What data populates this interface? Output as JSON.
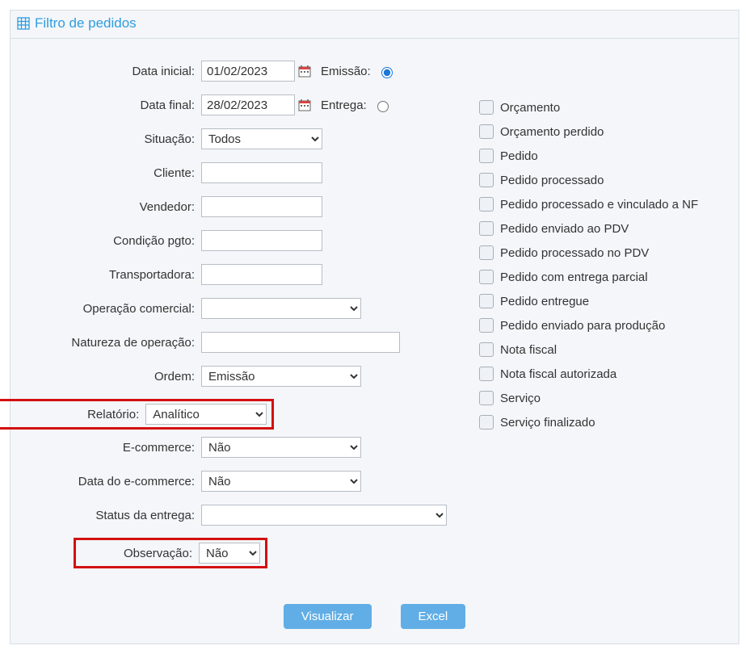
{
  "header": {
    "title": "Filtro de pedidos"
  },
  "form": {
    "data_inicial_label": "Data inicial:",
    "data_inicial_value": "01/02/2023",
    "data_final_label": "Data final:",
    "data_final_value": "28/02/2023",
    "emissao_label": "Emissão:",
    "entrega_label": "Entrega:",
    "situacao_label": "Situação:",
    "situacao_value": "Todos",
    "cliente_label": "Cliente:",
    "cliente_value": "",
    "vendedor_label": "Vendedor:",
    "vendedor_value": "",
    "condicao_pgto_label": "Condição pgto:",
    "condicao_pgto_value": "",
    "transportadora_label": "Transportadora:",
    "transportadora_value": "",
    "operacao_comercial_label": "Operação comercial:",
    "operacao_comercial_value": "",
    "natureza_operacao_label": "Natureza de operação:",
    "natureza_operacao_value": "",
    "ordem_label": "Ordem:",
    "ordem_value": "Emissão",
    "relatorio_label": "Relatório:",
    "relatorio_value": "Analítico",
    "ecommerce_label": "E-commerce:",
    "ecommerce_value": "Não",
    "data_ecommerce_label": "Data do e-commerce:",
    "data_ecommerce_value": "Não",
    "status_entrega_label": "Status da entrega:",
    "status_entrega_value": "",
    "observacao_label": "Observação:",
    "observacao_value": "Não"
  },
  "checks": {
    "c0": "Orçamento",
    "c1": "Orçamento perdido",
    "c2": "Pedido",
    "c3": "Pedido processado",
    "c4": "Pedido processado e vinculado a NF",
    "c5": "Pedido enviado ao PDV",
    "c6": "Pedido processado no PDV",
    "c7": "Pedido com entrega parcial",
    "c8": "Pedido entregue",
    "c9": "Pedido enviado para produção",
    "c10": "Nota fiscal",
    "c11": "Nota fiscal autorizada",
    "c12": "Serviço",
    "c13": "Serviço finalizado"
  },
  "buttons": {
    "visualizar": "Visualizar",
    "excel": "Excel"
  }
}
